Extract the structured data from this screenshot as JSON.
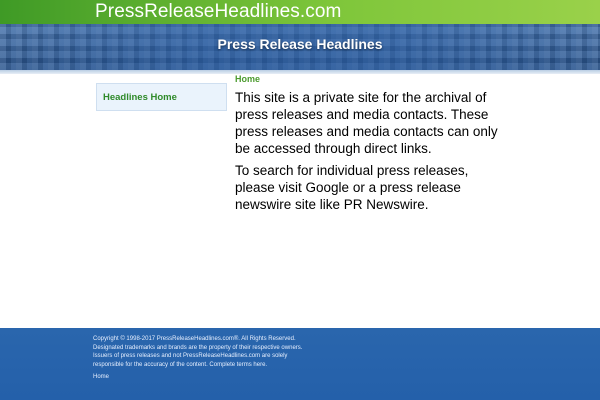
{
  "header": {
    "site_title": "PressReleaseHeadlines.com",
    "banner_title": "Press Release Headlines"
  },
  "sidebar": {
    "items": [
      {
        "label": "Headlines Home"
      }
    ]
  },
  "main": {
    "breadcrumb": "Home",
    "paragraphs": [
      "This site is a private site for the archival of press releases and media contacts. These press releases and media contacts can only be accessed through direct links.",
      "To search for individual press releases, please visit Google or a press release newswire site like PR Newswire."
    ]
  },
  "footer": {
    "lines": [
      "Copyright © 1998-2017 PressReleaseHeadlines.com®. All Rights Reserved.",
      "Designated trademarks and brands are the property of their respective owners.",
      "Issuers of press releases and not PressReleaseHeadlines.com are solely",
      "responsible for the accuracy of the content. Complete terms here."
    ],
    "home_link": "Home"
  },
  "colors": {
    "topbar_green": "#5fb52f",
    "banner_blue": "#2f5d9a",
    "link_green": "#2f8a2a",
    "footer_blue": "#2a66ad"
  }
}
